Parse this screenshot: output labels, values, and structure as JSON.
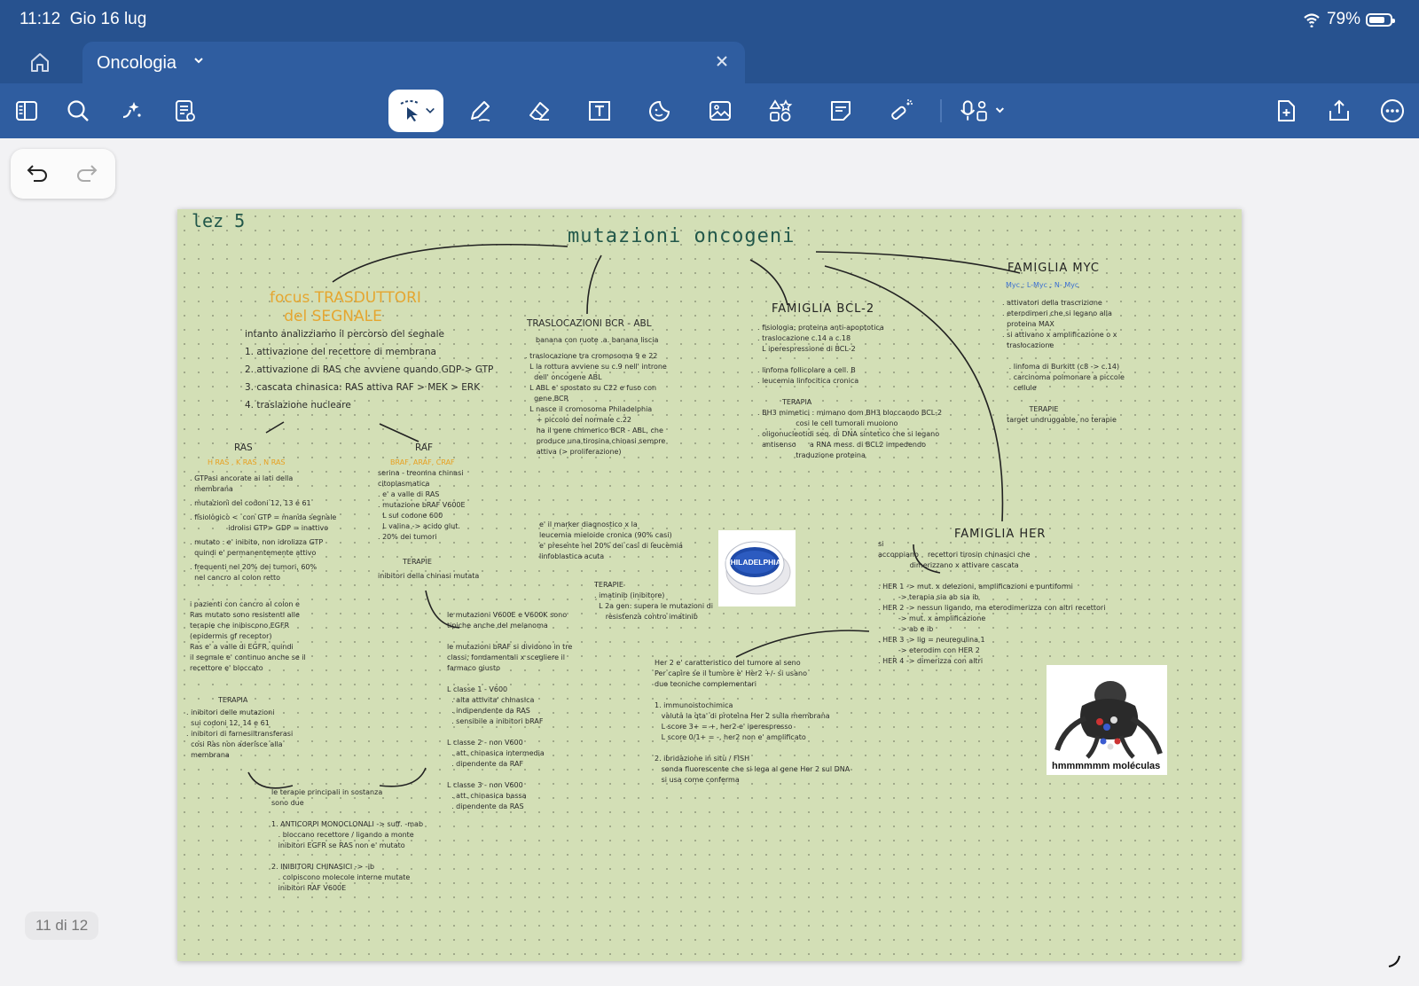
{
  "status_bar": {
    "time": "11:12",
    "date": "Gio 16 lug",
    "battery": "79%",
    "battery_level": 0.79
  },
  "tab": {
    "title": "Oncologia"
  },
  "toolbar": {
    "left_tools": [
      "sidebar-icon",
      "search-icon",
      "ai-sparkle-icon",
      "notes-list-icon"
    ],
    "center_tools": [
      "lasso-select-icon",
      "pen-icon",
      "eraser-icon",
      "text-box-icon",
      "sticker-icon",
      "image-icon",
      "shapes-icon",
      "sticky-note-icon",
      "laser-pointer-icon",
      "audio-record-icon"
    ],
    "right_tools": [
      "add-page-icon",
      "share-icon",
      "more-icon"
    ]
  },
  "page_indicator": "11 di 12",
  "note": {
    "lez": "lez 5",
    "title": "mutazioni oncogeni",
    "focus_title": "focus TRASDUTTORI\n   del SEGNALE",
    "focus_lines": [
      "intanto analizziamo il percorso del segnale",
      "1. attivazione del recettore di membrana",
      "2. attivazione di RAS che avviene quando GDP-> GTP",
      "3. cascata chinasica: RAS attiva RAF > MEK > ERK",
      "4. traslazione nucleare"
    ],
    "ras_title": "RAS",
    "ras_sub": "H RAS , K RAS , N RAS",
    "ras_lines": [
      ". GTPasi ancorate ai lati della\n  membrana",
      ". mutazioni dei codoni 12, 13 e 61",
      ". fisiologico <  con GTP = manda segnale\n                 idrolisi GTP> GDP = inattivo",
      ". mutato : e' inibito, non idrolizza GTP\n  quindi e' permanentemente attivo",
      ". frequenti nel 20% dei tumori, 60%\n  nel cancro al colon retto"
    ],
    "ras_para": "i pazienti con cancro al colon e\nRas mutato sono resistenti alle\nterapie che inibiscono EGFR\n(epidermis gf receptor)\nRas e' a valle di EGFR, quindi\nil segnale e' continuo anche se il\nrecettore e' bloccato",
    "ras_terapia": "TERAPIA",
    "ras_terapia_lines": ". inibitori delle mutazioni\n  sui codoni 12, 14 e 61\n. inibitori di farnesiltransferasi\n  cosi Ras non aderisce alla\n  membrana",
    "raf_title": "RAF",
    "raf_sub": "BRAF, ARAF, CRAF",
    "raf_lines": "serina - treonina chinasi\ncitoplasmatica\n. e' a valle di RAS\n. mutazione bRAF V600E\n  L sul codone 600\n  L valina -> acido glut.\n. 20% dei tumori",
    "raf_terapia": "TERAPIE",
    "raf_terapia_line": "inibitori della chinasi mutata",
    "braf_note": "le mutazioni V600E e V600K sono\ntipiche anche del melanoma\n\nle mutazioni bRAF si dividono in tre\nclassi, fondamentali x scegliere il\nfarmaco giusto\n\nL classe 1 - V600\n  . alta attivita' chinasica\n  . indipendente da RAS\n  . sensibile a inibitori bRAF\n\nL classe 2 - non V600\n  . att. chinasica intermedia\n  . dipendente da RAF\n\nL classe 3 - non V600\n  . att. chinasica bassa\n  . dipendente da RAS",
    "terapie_bottom": "le terapie principali in sostanza\nsono due\n\n1. ANTICORPI MONOCLONALI -> suff. -mab\n   . bloccano recettore / ligando a monte\n   inibitori EGFR se RAS non e' mutato\n\n2. INIBITORI CHINASICI -> -ib\n   . colpiscono molecole interne mutate\n   inibitori RAF V600E",
    "bcr_title": "TRASLOCAZIONI BCR - ABL",
    "bcr_sub": "banana con ruote .a. banana liscia",
    "bcr_lines": ". traslocazione tra cromosoma 9 e 22\n  L la rottura avviene su c.9 nell' introne\n    dell' oncogene ABL\n  L ABL e' spostato su C22 e fuso con\n    gene BCR\n  L nasce il cromosoma Philadelphia\n     + piccolo del normale c.22\n     ha il gene chimerico BCR - ABL, che\n     produce una tirosina chinasi sempre\n     attiva (> proliferazione)",
    "bcr_marker": "e' il marker diagnostico x la\nleucemia mieloide cronica (90% casi)\ne' presente nel 20% dei casi di leucemia\nlinfoblastica acuta",
    "bcr_terapie": "TERAPIE\n. imatinib (inibitore)\n  L 2a gen: supera le mutazioni di\n     resistenza contro imatinib",
    "phil_label": "PHILADELPHIA",
    "bcl2_title": "FAMIGLIA BCL-2",
    "bcl2_lines": ". fisiologia: proteina anti-apoptotica\n. traslocazione c.14 a c.18\n  L iperespressione di BCL-2\n\n. linfoma follicolare a cell. B\n. leucemia linfocitica cronica\n\n           TERAPIA\n. BH3 mimetici : mimano dom BH3 bloccando BCL-2\n                 cosi le cell tumorali muoiono\n. oligonucleotidi seq. di DNA sintetico che si legano\n  antisenso      a RNA mess. di BCL2 impedendo\n                 traduzione proteina",
    "myc_title": "FAMIGLIA MYC",
    "myc_sub": "Myc ; L-Myc ; N- Myc",
    "myc_lines": ". attivatori della trascrizione\n. eterodimeri che si legano alla\n  proteina MAX\n. si attivano x amplificazione o x\n  traslocazione\n\n   . linfoma di Burkitt (c8 -> c.14)\n   . carcinoma polmonare a piccole\n     cellule\n\n            TERAPIE\n  target undruggable, no terapie",
    "her_title": "FAMIGLIA HER",
    "her_lines": "si\naccoppiano    recettori tirosin chinasici che\n              dimerizzano x attivare cascata\n\n. HER 1 -> mut. x delezioni, amplificazioni e puntiformi\n         -> terapia sia ab sia ib\n. HER 2 -> nessun ligando, ma eterodimerizza con altri recettori\n         -> mut. x amplificazione\n         -> ab e ib\n. HER 3 -> lig = neuregulina 1\n         -> eterodim con HER 2\n. HER 4 -> dimerizza con altri",
    "her2_note": "Her 2 e' caratteristico del tumore al seno\nPer capire se il tumore e' Her2 +/- si usano\ndue tecniche complementari\n\n1. immunoistochimica\n   valuta la qta' di proteina Her 2 sulla membrana\n   L score 3+ = +, her2 e' iperespresso\n   L score 0/1+ = -, her2 non e' amplificato\n\n2. ibridazione in situ / FISH\n   sonda fluorescente che si lega al gene Her 2 sul DNA\n   si usa come conferma",
    "meme_caption": "hmmmmmm moléculas"
  }
}
